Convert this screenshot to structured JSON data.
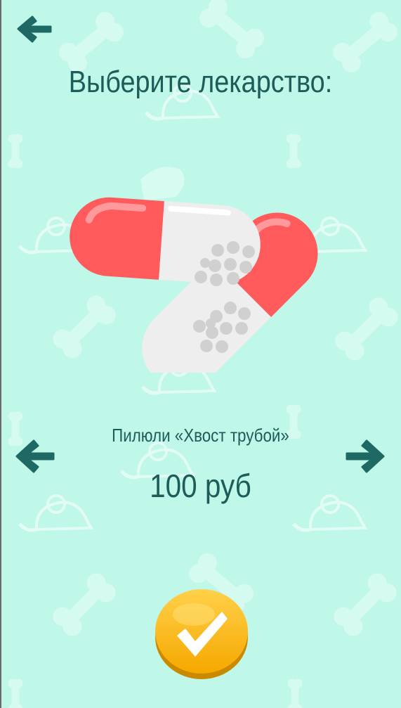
{
  "screen": {
    "title": "Выберите лекарство:",
    "background_color": "#bff7e8",
    "text_color": "#1d5c58"
  },
  "nav": {
    "back_icon": "arrow-left-icon",
    "prev_icon": "arrow-left-icon",
    "next_icon": "arrow-right-icon"
  },
  "item": {
    "name": "Пилюли «Хвост трубой»",
    "price": "100 руб",
    "image_icon": "capsule-pills-icon"
  },
  "confirm": {
    "icon": "checkmark-icon",
    "color": "#f7b500"
  }
}
